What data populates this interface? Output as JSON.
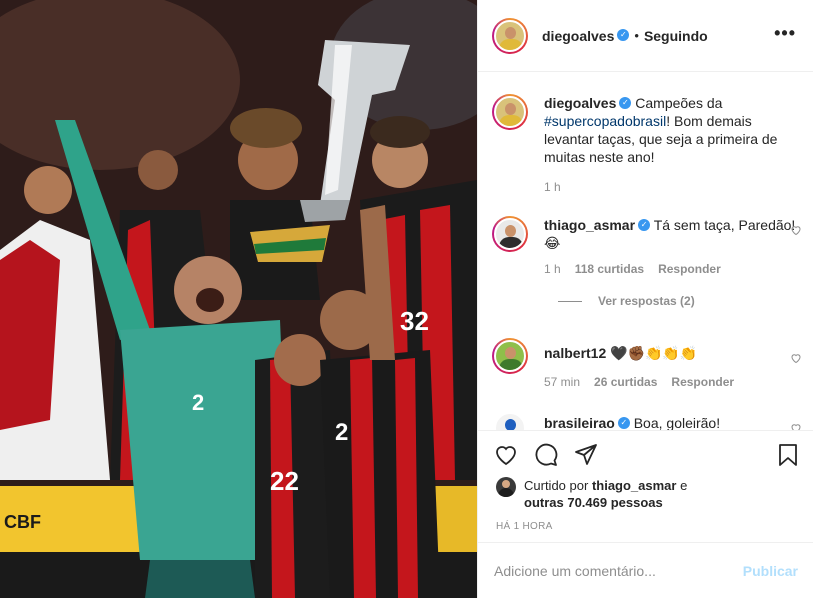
{
  "post": {
    "author": "diegoalves",
    "verified_icon": "verified-badge-icon",
    "follow_status": "Seguindo",
    "more_icon": "more-options-icon",
    "image_alt_icon": "post-photo"
  },
  "caption": {
    "username": "diegoalves",
    "text_before": "Campeões da ",
    "hashtag": "#supercopadobrasil",
    "text_after": "! Bom demais levantar taças, que seja a primeira de muitas neste ano!",
    "time": "1 h"
  },
  "comments": [
    {
      "username": "thiago_asmar",
      "verified": true,
      "text": "Tá sem taça, Paredão! 😂",
      "time": "1 h",
      "likes": "118 curtidas",
      "reply": "Responder",
      "view_replies": "Ver respostas (2)"
    },
    {
      "username": "nalbert12",
      "verified": false,
      "text": "🖤✊🏾👏👏👏",
      "time": "57 min",
      "likes": "26 curtidas",
      "reply": "Responder"
    },
    {
      "username": "brasileirao",
      "verified": true,
      "text": "Boa, goleirão!"
    }
  ],
  "actions": {
    "like_icon": "heart-icon",
    "comment_icon": "comment-icon",
    "share_icon": "share-icon",
    "save_icon": "bookmark-icon"
  },
  "likes": {
    "prefix": "Curtido por",
    "user": "thiago_asmar",
    "connector": "e",
    "others": "outras 70.469 pessoas"
  },
  "posted_ago": "HÁ 1 HORA",
  "comment_box": {
    "placeholder": "Adicione um comentário...",
    "publish": "Publicar"
  },
  "colors": {
    "link_blue": "#00376b",
    "verified_blue": "#3897f0",
    "publish_disabled": "#b2dffc",
    "muted_text": "#8e8e8e"
  }
}
